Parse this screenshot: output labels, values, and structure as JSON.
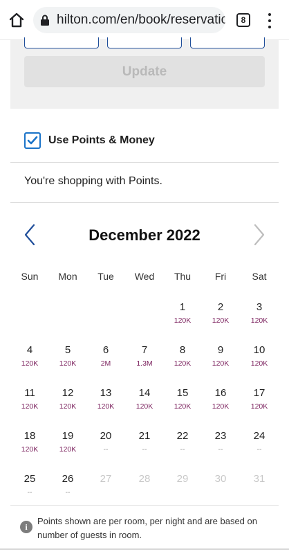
{
  "browser": {
    "url": "hilton.com/en/book/reservatic",
    "tab_count": "8"
  },
  "filters": {
    "update_label": "Update"
  },
  "points_toggle": {
    "label": "Use Points & Money",
    "checked": true
  },
  "shopping_message": "You're shopping with Points.",
  "calendar": {
    "month_title": "December 2022",
    "weekdays": [
      "Sun",
      "Mon",
      "Tue",
      "Wed",
      "Thu",
      "Fri",
      "Sat"
    ],
    "weeks": [
      [
        null,
        null,
        null,
        null,
        {
          "day": "1",
          "price": "120K"
        },
        {
          "day": "2",
          "price": "120K"
        },
        {
          "day": "3",
          "price": "120K"
        }
      ],
      [
        {
          "day": "4",
          "price": "120K"
        },
        {
          "day": "5",
          "price": "120K"
        },
        {
          "day": "6",
          "price": "2M"
        },
        {
          "day": "7",
          "price": "1.3M"
        },
        {
          "day": "8",
          "price": "120K"
        },
        {
          "day": "9",
          "price": "120K"
        },
        {
          "day": "10",
          "price": "120K"
        }
      ],
      [
        {
          "day": "11",
          "price": "120K"
        },
        {
          "day": "12",
          "price": "120K"
        },
        {
          "day": "13",
          "price": "120K"
        },
        {
          "day": "14",
          "price": "120K"
        },
        {
          "day": "15",
          "price": "120K"
        },
        {
          "day": "16",
          "price": "120K"
        },
        {
          "day": "17",
          "price": "120K"
        }
      ],
      [
        {
          "day": "18",
          "price": "120K"
        },
        {
          "day": "19",
          "price": "120K"
        },
        {
          "day": "20",
          "price": "--"
        },
        {
          "day": "21",
          "price": "--"
        },
        {
          "day": "22",
          "price": "--"
        },
        {
          "day": "23",
          "price": "--"
        },
        {
          "day": "24",
          "price": "--"
        }
      ],
      [
        {
          "day": "25",
          "price": "--"
        },
        {
          "day": "26",
          "price": "--"
        },
        {
          "day": "27",
          "price": "",
          "disabled": true
        },
        {
          "day": "28",
          "price": "",
          "disabled": true
        },
        {
          "day": "29",
          "price": "",
          "disabled": true
        },
        {
          "day": "30",
          "price": "",
          "disabled": true
        },
        {
          "day": "31",
          "price": "",
          "disabled": true
        }
      ]
    ]
  },
  "note": {
    "icon": "i",
    "text": "Points shown are per room, per night and are based on number of guests in room."
  },
  "colors": {
    "price": "#7a1f5c",
    "accent": "#1a73c8",
    "nav": "#1f4e9a"
  }
}
